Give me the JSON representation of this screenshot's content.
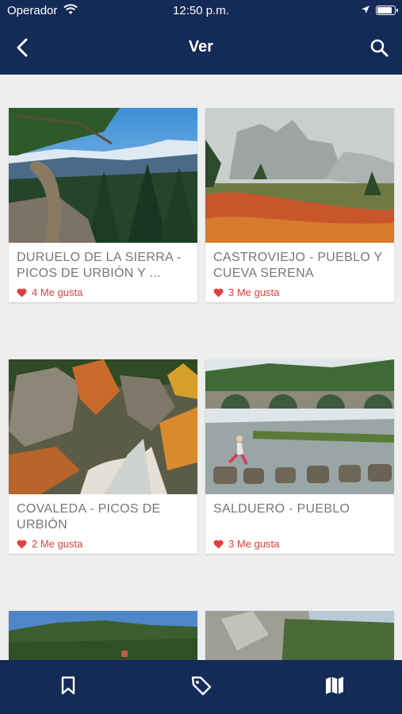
{
  "status_bar": {
    "carrier": "Operador",
    "time": "12:50 p.m."
  },
  "nav": {
    "title": "Ver"
  },
  "places": [
    {
      "name": "DURUELO DE LA SIERRA - PICOS DE URBIÓN Y ...",
      "likes": "4 Me gusta"
    },
    {
      "name": "CASTROVIEJO - PUEBLO Y CUEVA SERENA",
      "likes": "3 Me gusta"
    },
    {
      "name": "COVALEDA - PICOS DE URBIÓN",
      "likes": "2 Me gusta"
    },
    {
      "name": "SALDUERO - PUEBLO",
      "likes": "3 Me gusta"
    }
  ],
  "tabs": [
    {
      "icon": "bookmark-icon"
    },
    {
      "icon": "tag-icon"
    },
    {
      "icon": "map-icon"
    }
  ],
  "colors": {
    "header": "#142a57",
    "like": "#e53e3e",
    "background": "#eeeeee"
  }
}
